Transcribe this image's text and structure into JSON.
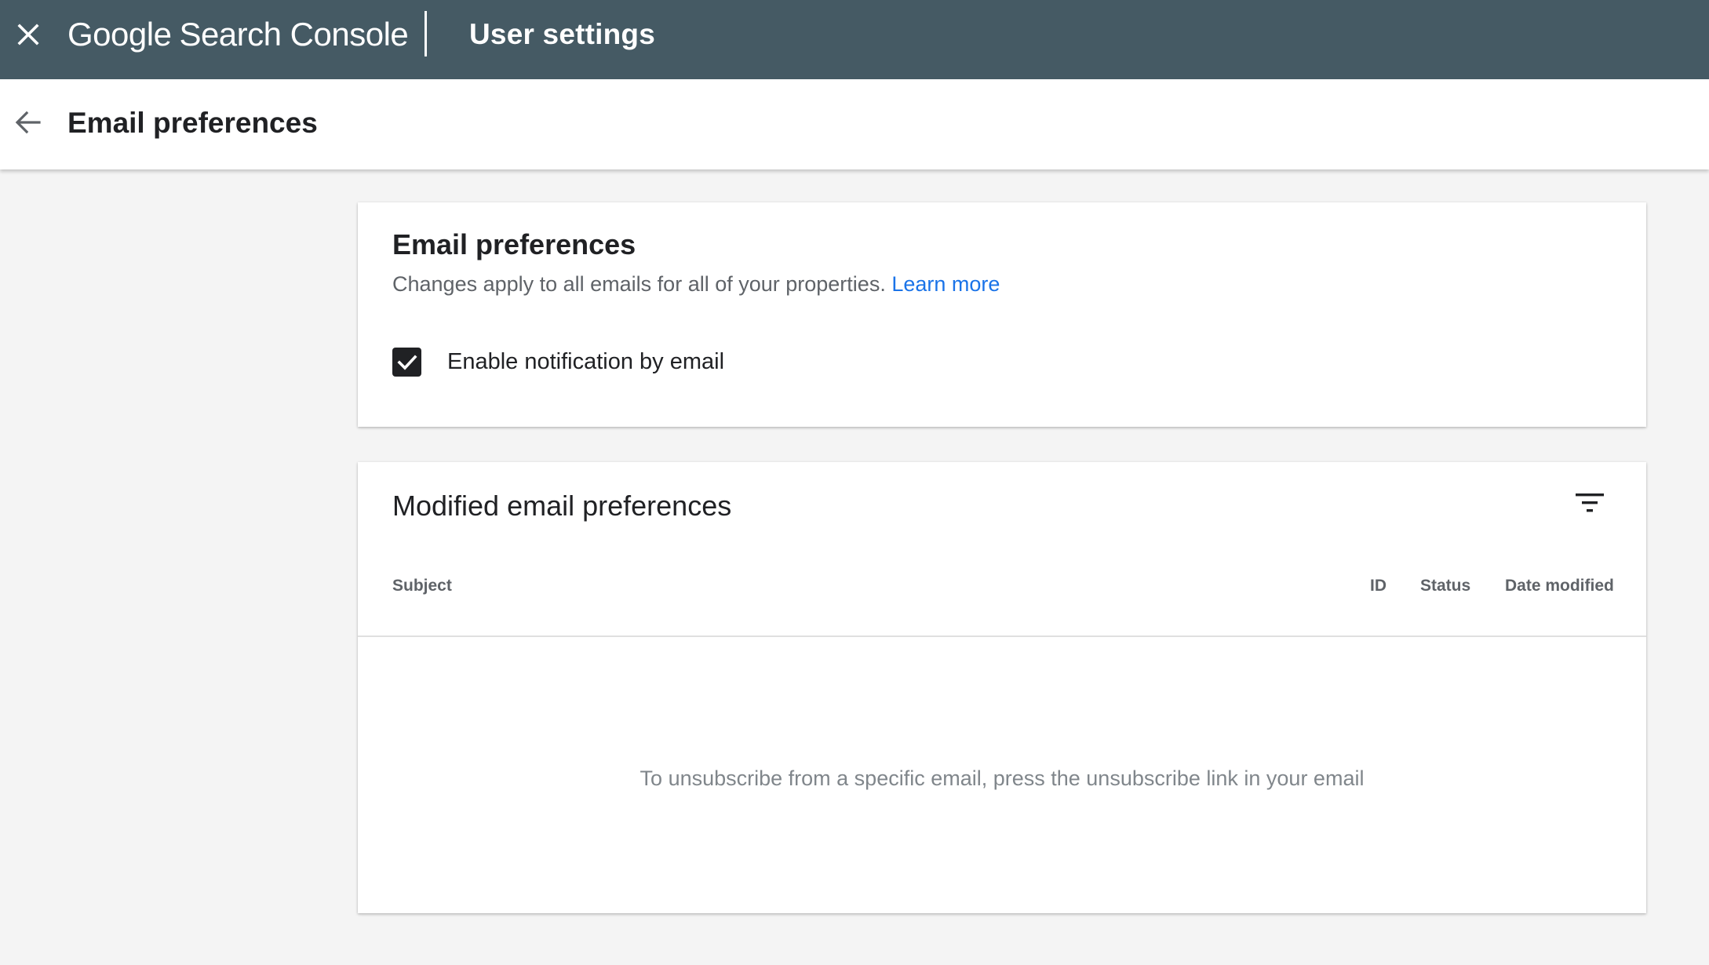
{
  "topbar": {
    "close_icon": "close-icon",
    "logo_google": "Google",
    "logo_product": "Search Console",
    "app_title": "User settings",
    "background_color": "#455a64"
  },
  "subheader": {
    "back_icon": "arrow-back-icon",
    "title": "Email preferences"
  },
  "email_preferences_card": {
    "title": "Email preferences",
    "description": "Changes apply to all emails for all of your properties.",
    "learn_more": "Learn more",
    "checkbox_label": "Enable notification by email",
    "checkbox_checked": true,
    "link_color": "#1a73e8"
  },
  "modified_card": {
    "title": "Modified email preferences",
    "filter_icon": "filter-icon",
    "columns": [
      "Subject",
      "ID",
      "Status",
      "Date modified"
    ],
    "rows": [],
    "empty_message": "To unsubscribe from a specific email, press the unsubscribe link in your email"
  }
}
